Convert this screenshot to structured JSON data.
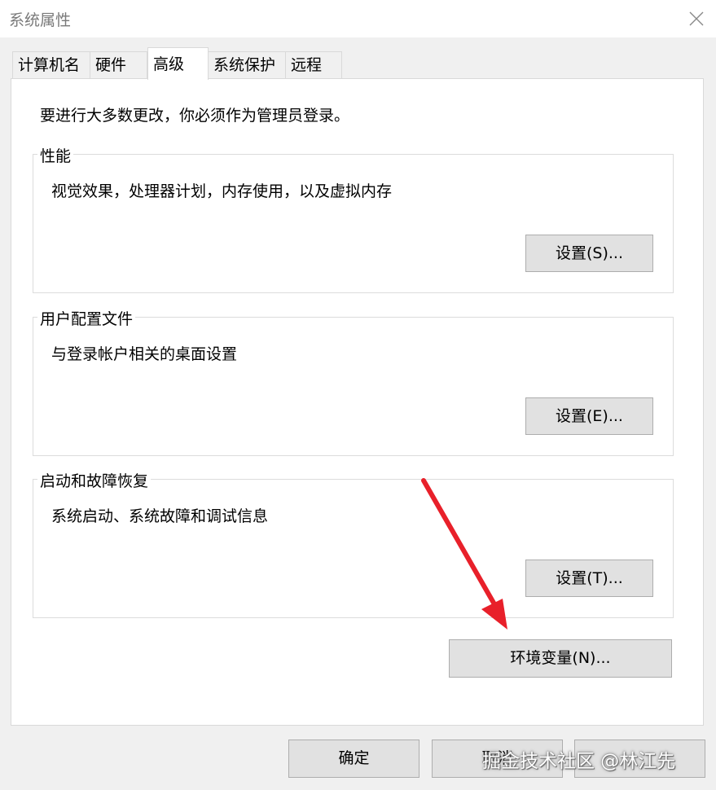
{
  "window": {
    "title": "系统属性"
  },
  "tabs": [
    {
      "label": "计算机名",
      "active": false
    },
    {
      "label": "硬件",
      "active": false
    },
    {
      "label": "高级",
      "active": true
    },
    {
      "label": "系统保护",
      "active": false
    },
    {
      "label": "远程",
      "active": false
    }
  ],
  "advanced": {
    "admin_note": "要进行大多数更改，你必须作为管理员登录。",
    "performance": {
      "title": "性能",
      "description": "视觉效果，处理器计划，内存使用，以及虚拟内存",
      "button": "设置(S)..."
    },
    "user_profiles": {
      "title": "用户配置文件",
      "description": "与登录帐户相关的桌面设置",
      "button": "设置(E)..."
    },
    "startup_recovery": {
      "title": "启动和故障恢复",
      "description": "系统启动、系统故障和调试信息",
      "button": "设置(T)..."
    },
    "env_button": "环境变量(N)..."
  },
  "footer": {
    "ok": "确定",
    "cancel": "取消",
    "apply": ""
  },
  "annotation": {
    "arrow_color": "#e8202a"
  },
  "watermark": "掘金技术社区 @林江先"
}
